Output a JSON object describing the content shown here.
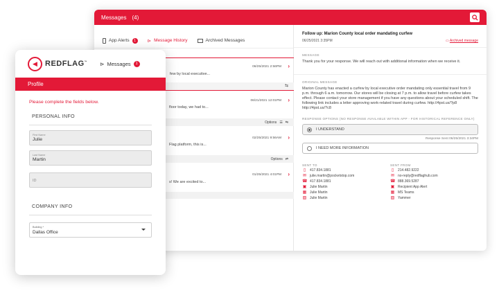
{
  "window": {
    "title": "Messages",
    "count": "(4)",
    "tabs": [
      {
        "label": "App Alerts",
        "badge": "1"
      },
      {
        "label": "Message History"
      },
      {
        "label": "Archived Messages"
      }
    ],
    "messages": [
      {
        "date": "06/25/2021 2:56PM",
        "snippet": "few by local executive..."
      },
      {
        "date": "06/21/2021 12:01PM",
        "snippet": "floor today, we had to..."
      },
      {
        "date": "02/25/2021 9:56AM",
        "snippet": "Flag platform, this is..."
      },
      {
        "date": "01/25/2021 4:01PM",
        "snippet": "s! We are excited to..."
      }
    ],
    "options_label_1": "Options",
    "options_label_2": "Options",
    "detail": {
      "title": "Follow up: Marion County local order mandating curfew",
      "timestamp": "06/25/2021 3:35PM",
      "archive": "Archived message",
      "message_label": "MESSAGE",
      "message_text": "Thank you for your response. We will reach out with additional information when we receive it.",
      "original_label": "ORIGINAL MESSAGE",
      "original_text": "Marion County has enacted a curfew by local executive order mandating only essential travel from 9 p.m. through 6 a.m. tomorrow. Our stores will be closing at 7 p.m. to allow travel before curfew takes effect. Please contact your store management if you have any questions about your scheduled shift. The following link includes a letter approving work-related travel during curfew. http://4pst.us/?p8 http://4pst.us/?c8",
      "response_label": "RESPONSE OPTIONS (NO RESPONSE AVAILABLE WITHIN APP - FOR HISTORICAL REFERENCE ONLY)",
      "option1": "I UNDERSTAND",
      "response_sent": "Response Sent 06/25/2021 3:34PM",
      "option2": "I NEED MORE INFORMATION",
      "sent_to_label": "SENT TO",
      "sent_to": [
        {
          "icon": "phone-icon",
          "text": "417.834.1881"
        },
        {
          "icon": "mail-icon",
          "text": "julie.martin@pocketstop.com"
        },
        {
          "icon": "call-icon",
          "text": "417.834.1881"
        },
        {
          "icon": "app-icon",
          "text": "Julie Martin"
        },
        {
          "icon": "teams-icon",
          "text": "Julie Martin"
        },
        {
          "icon": "yammer-icon",
          "text": "Julie Martin"
        }
      ],
      "sent_from_label": "SENT FROM",
      "sent_from": [
        {
          "icon": "phone-icon",
          "text": "214.482.9222"
        },
        {
          "icon": "mail-icon",
          "text": "no-reply@redflaghub.com"
        },
        {
          "icon": "call-icon",
          "text": "888.369.5287"
        },
        {
          "icon": "app-icon",
          "text": "Recipient App Alert"
        },
        {
          "icon": "teams-icon",
          "text": "MS Teams"
        },
        {
          "icon": "yammer-icon",
          "text": "Yammer"
        }
      ]
    }
  },
  "card": {
    "brand": "REDFLAG",
    "messages_label": "Messages",
    "messages_badge": "1",
    "profile_title": "Profile",
    "hint": "Please complete the fields below.",
    "personal_header": "PERSONAL INFO",
    "first_name_label": "First Name",
    "first_name_value": "Julie",
    "last_name_label": "Last Name",
    "last_name_value": "Martin",
    "id_placeholder": "ID",
    "company_header": "COMPANY INFO",
    "building_label": "Building *",
    "building_value": "Dallas Office"
  },
  "colors": {
    "accent": "#e31937"
  }
}
